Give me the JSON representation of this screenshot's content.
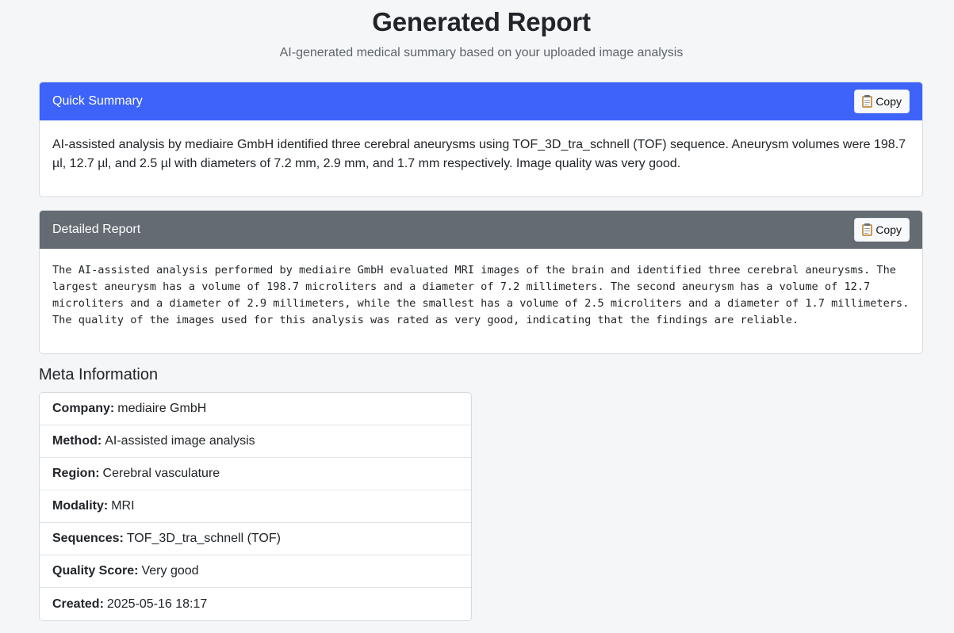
{
  "header": {
    "title": "Generated Report",
    "subtitle": "AI-generated medical summary based on your uploaded image analysis"
  },
  "quick_summary": {
    "title": "Quick Summary",
    "copy_label": "Copy",
    "text": "AI-assisted analysis by mediaire GmbH identified three cerebral aneurysms using TOF_3D_tra_schnell (TOF) sequence. Aneurysm volumes were 198.7 µl, 12.7 µl, and 2.5 µl with diameters of 7.2 mm, 2.9 mm, and 1.7 mm respectively. Image quality was very good."
  },
  "detailed_report": {
    "title": "Detailed Report",
    "copy_label": "Copy",
    "text": "The AI-assisted analysis performed by mediaire GmbH evaluated MRI images of the brain and identified three cerebral aneurysms. The largest aneurysm has a volume of 198.7 microliters and a diameter of 7.2 millimeters. The second aneurysm has a volume of 12.7 microliters and a diameter of 2.9 millimeters, while the smallest has a volume of 2.5 microliters and a diameter of 1.7 millimeters. The quality of the images used for this analysis was rated as very good, indicating that the findings are reliable."
  },
  "meta": {
    "title": "Meta Information",
    "items": [
      {
        "label": "Company:",
        "value": "mediaire GmbH"
      },
      {
        "label": "Method:",
        "value": "AI-assisted image analysis"
      },
      {
        "label": "Region:",
        "value": "Cerebral vasculature"
      },
      {
        "label": "Modality:",
        "value": "MRI"
      },
      {
        "label": "Sequences:",
        "value": "TOF_3D_tra_schnell (TOF)"
      },
      {
        "label": "Quality Score:",
        "value": "Very good"
      },
      {
        "label": "Created:",
        "value": "2025-05-16 18:17"
      }
    ]
  },
  "colors": {
    "primary_header": "#3d63fb",
    "secondary_header": "#646b73",
    "page_background": "#f5f6f8"
  },
  "icons": {
    "copy": "clipboard-icon"
  }
}
